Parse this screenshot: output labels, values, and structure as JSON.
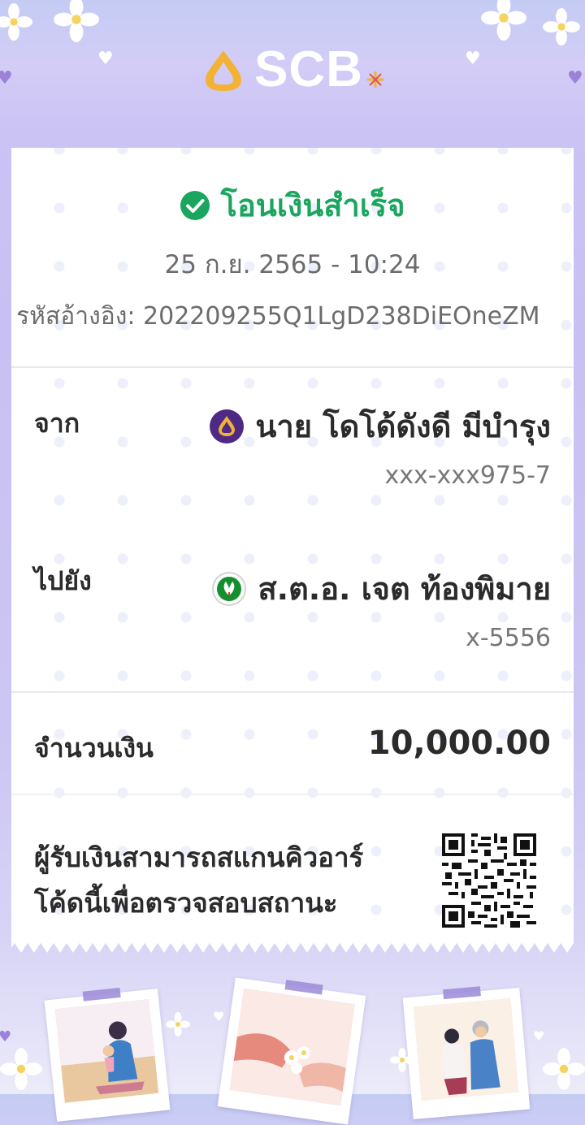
{
  "brand": {
    "name": "SCB",
    "logo_color": "#f2b233"
  },
  "status": {
    "text": "โอนเงินสำเร็จ",
    "icon": "check-circle-icon",
    "color": "#1aa65e"
  },
  "datetime": "25 ก.ย. 2565 - 10:24",
  "reference": {
    "label": "รหัสอ้างอิง:",
    "value": "202209255Q1LgD238DiEOneZM"
  },
  "from": {
    "label": "จาก",
    "name": "นาย โดโด้ดังดี มีบำรุง",
    "account": "xxx-xxx975-7",
    "bank_icon": "scb-bank-icon",
    "bank_color": "#4e2a84"
  },
  "to": {
    "label": "ไปยัง",
    "name": "ส.ต.อ. เจต ท้องพิมาย",
    "account": "x-5556",
    "bank_icon": "kbank-bank-icon",
    "bank_color": "#138f2d"
  },
  "amount": {
    "label": "จำนวนเงิน",
    "value": "10,000.00"
  },
  "qr_note": {
    "line1": "ผู้รับเงินสามารถสแกนคิวอาร์",
    "line2": "โค้ดนี้เพื่อตรวจสอบสถานะ"
  }
}
